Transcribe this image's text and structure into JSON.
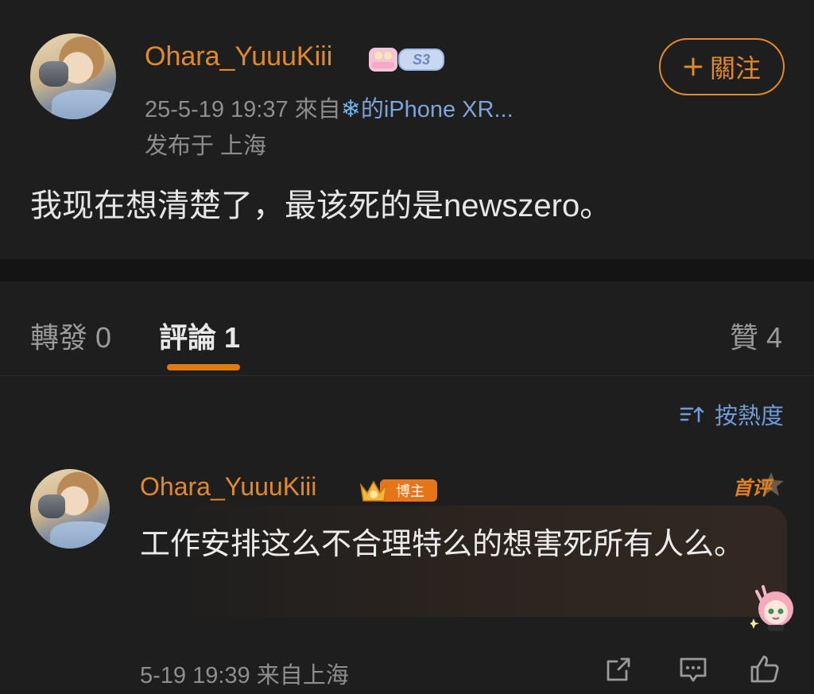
{
  "post": {
    "username": "Ohara_YuuuKiii",
    "badge_text": "S3",
    "timestamp": "25-5-19 19:37",
    "source_prefix": "來自",
    "source_suffix": "的",
    "device": "iPhone XR...",
    "location": "发布于 上海",
    "follow_label": "關注",
    "text": "我现在想清楚了，最该死的是newszero。"
  },
  "tabs": {
    "repost": "轉發 0",
    "comments": "評論 1",
    "likes": "贊 4"
  },
  "sort_label": "按熱度",
  "comment": {
    "username": "Ohara_YuuuKiii",
    "crown_badge_text": "博主",
    "first_comment_label": "首评",
    "text": "工作安排这么不合理特么的想害死所有人么。",
    "timestamp": "5-19 19:39",
    "location": "来自上海"
  },
  "colors": {
    "accent": "#e28a2b",
    "link": "#6f9bd8",
    "background": "#1e1e1e"
  }
}
